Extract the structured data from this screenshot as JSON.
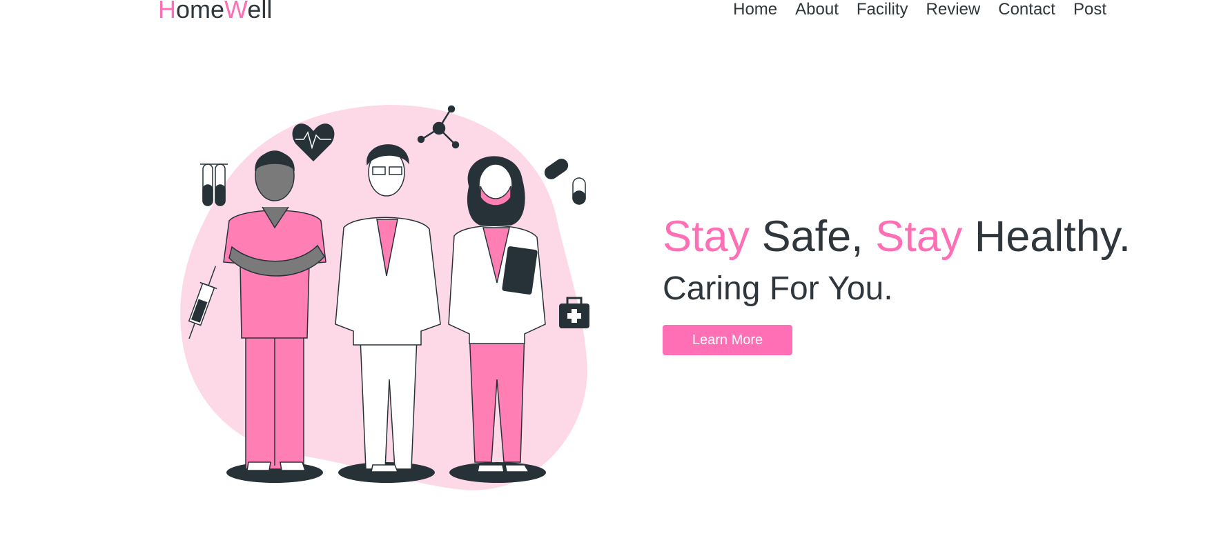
{
  "brand": {
    "logo_h": "H",
    "logo_ome": "ome",
    "logo_w": "W",
    "logo_ell": "ell"
  },
  "nav": {
    "items": [
      "Home",
      "About",
      "Facility",
      "Review",
      "Contact",
      "Post"
    ]
  },
  "hero": {
    "title_stay_1": "Stay",
    "title_safe": " Safe, ",
    "title_stay_2": "Stay",
    "title_healthy": " Healthy.",
    "subtitle": "Caring For You.",
    "cta_label": "Learn More"
  },
  "colors": {
    "accent": "#ff6fb5",
    "text": "#2f363c",
    "blob": "#fdd9e8",
    "dark": "#263238"
  },
  "illustration": {
    "icons": [
      "heart-pulse-icon",
      "molecule-icon",
      "test-tubes-icon",
      "pill-icon",
      "syringe-icon",
      "first-aid-kit-icon"
    ]
  }
}
